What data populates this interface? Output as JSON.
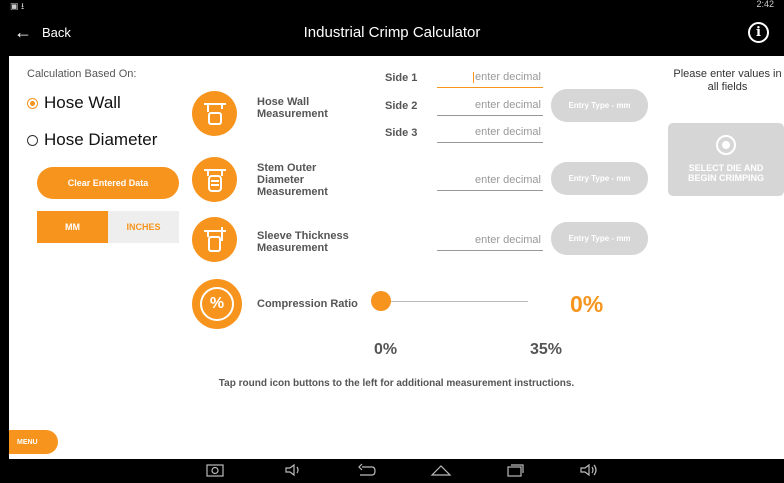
{
  "statusbar": {
    "left_icons": "▣ ⭳",
    "time": "2:42"
  },
  "appbar": {
    "back_label": "Back",
    "back_arrow": "←",
    "title": "Industrial Crimp Calculator",
    "info_glyph": "i"
  },
  "sidebar": {
    "calc_label": "Calculation Based On:",
    "options": [
      {
        "label": "Hose Wall",
        "selected": true
      },
      {
        "label": "Hose Diameter",
        "selected": false
      }
    ],
    "clear_button": "Clear Entered Data",
    "units": {
      "mm": "MM",
      "inches": "INCHES",
      "selected": "MM"
    },
    "menu": "MENU"
  },
  "measurements": {
    "hose_wall": {
      "label_line1": "Hose Wall",
      "label_line2": "Measurement"
    },
    "stem_outer": {
      "label_line1": "Stem Outer",
      "label_line2": "Diameter",
      "label_line3": "Measurement"
    },
    "sleeve": {
      "label_line1": "Sleeve Thickness",
      "label_line2": "Measurement"
    },
    "compression": {
      "label": "Compression Ratio",
      "icon_glyph": "%"
    }
  },
  "fields": {
    "side1_label": "Side 1",
    "side2_label": "Side 2",
    "side3_label": "Side 3",
    "placeholder": "enter decimal",
    "entry_type": "Entry Type - mm"
  },
  "right_panel": {
    "please": "Please enter values in all fields",
    "select_die_line1": "SELECT DIE AND",
    "select_die_line2": "BEGIN CRIMPING"
  },
  "slider": {
    "value_label": "0%",
    "min_label": "0%",
    "max_label": "35%",
    "value": 0
  },
  "hint": "Tap round icon buttons to the left for additional measurement instructions.",
  "colors": {
    "accent": "#f7941d",
    "disabled": "#d6d6d6",
    "text": "#555555"
  },
  "navbar_icons": [
    "camera-icon",
    "volume-down-icon",
    "back-nav-icon",
    "home-nav-icon",
    "recents-nav-icon",
    "volume-up-icon"
  ]
}
